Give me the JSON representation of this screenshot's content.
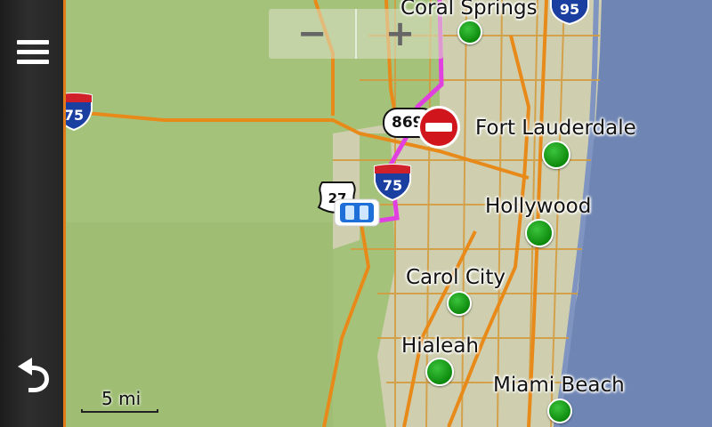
{
  "sidebar": {
    "menu_icon": "hamburger-menu-icon",
    "back_icon": "back-arrow-icon"
  },
  "zoom": {
    "zoom_out_label": "−",
    "zoom_in_label": "+"
  },
  "map": {
    "water_color": "#6f86b4",
    "land_color": "#a4c27a",
    "urban_color": "#cfcfb0",
    "route_color": "#e040e0",
    "cities": [
      {
        "name": "Coral Springs"
      },
      {
        "name": "Fort Lauderdale"
      },
      {
        "name": "Hollywood"
      },
      {
        "name": "Carol City"
      },
      {
        "name": "Hialeah"
      },
      {
        "name": "Miami Beach"
      }
    ],
    "shields": {
      "i95": "95",
      "i75_left": "75",
      "i75_main": "75",
      "us27": "27",
      "road869": "869"
    },
    "scale": {
      "label": "5 mi"
    }
  }
}
